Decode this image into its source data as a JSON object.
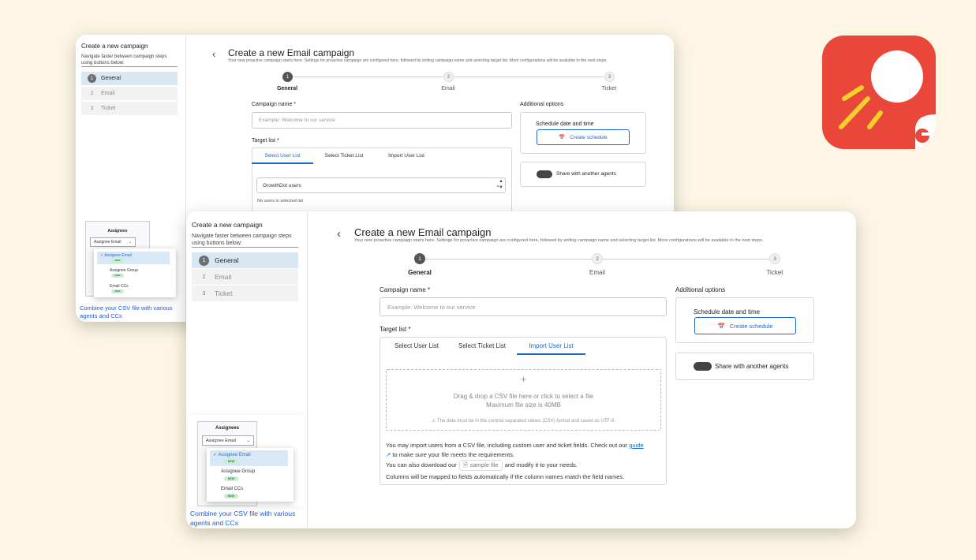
{
  "sidebar": {
    "title": "Create a new campaign",
    "subtitle": "Navigate faster between campaign steps using buttons below:",
    "steps": [
      {
        "num": "1",
        "label": "General"
      },
      {
        "num": "2",
        "label": "Email"
      },
      {
        "num": "3",
        "label": "Ticket"
      }
    ],
    "promo": {
      "heading": "Assignees",
      "select_value": "Assignee Email",
      "options": [
        {
          "label": "Assignee Email",
          "badge": "NEW"
        },
        {
          "label": "Assignee Group",
          "badge": "NEW"
        },
        {
          "label": "Email CCs",
          "badge": "NEW"
        }
      ],
      "link": "Combine your CSV file with various agents and CCs"
    }
  },
  "header": {
    "title": "Create a new Email campaign",
    "subtitle_back": "Your new proactive campaign starts here. Settings for proactive campaign are configured here, followed by writing campaign name and selecting target list. More configurations will be available in the next steps.",
    "subtitle_front": "Your new proactive campaign starts here. Settings for proactive campaign are configured here, followed by writing campaign name and selecting target list. More configurations will be available in the next steps."
  },
  "stepper": [
    {
      "num": "1",
      "label": "General"
    },
    {
      "num": "2",
      "label": "Email"
    },
    {
      "num": "3",
      "label": "Ticket"
    }
  ],
  "form": {
    "campaign_name_label": "Campaign name *",
    "campaign_name_placeholder": "Example: Welcome to our service",
    "target_list_label": "Target list *",
    "tabs": [
      "Select User List",
      "Select Ticket List",
      "Import User List"
    ],
    "user_list_value": "GrowthDot users",
    "no_users_text": "No users in selected list",
    "dropzone": {
      "plus": "+",
      "line1": "Drag & drop a CSV file here or click to select a file",
      "line2": "Maximum file size is 40MB",
      "warning": "The data must be in the comma separated values (CSV) format and saved as UTF-8."
    },
    "import_info": {
      "p1": "You may import users from a CSV file, including custom user and ticket fields. Check out our",
      "guide_link": "guide",
      "p1b": "to make sure your file meets the requirements.",
      "p2a": "You can also download our",
      "sample_file": "sample file",
      "p2b": "and modify it to your needs.",
      "p3": "Columns will be mapped to fields automatically if the column names match the field names."
    }
  },
  "options": {
    "title": "Additional options",
    "schedule_label": "Schedule date and time",
    "create_schedule": "Create schedule",
    "share_label": "Share with another agents"
  },
  "colors": {
    "background": "#fdf6e4",
    "accent": "#1f67c4",
    "app_icon": "#e8473a"
  }
}
